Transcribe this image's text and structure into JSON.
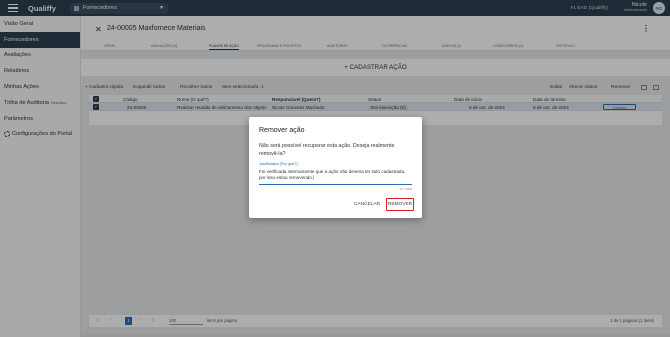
{
  "topbar": {
    "app_name": "Qualiffy",
    "module": "Fornecedores",
    "env": "FL EAD (Qualiffy)",
    "user_name": "Nicole",
    "user_role": "Administrador",
    "avatar": "NG"
  },
  "sidebar": {
    "items": [
      {
        "label": "Visão Geral",
        "sub": ""
      },
      {
        "label": "Fornecedores",
        "sub": ""
      },
      {
        "label": "Avaliações",
        "sub": ""
      },
      {
        "label": "Relatórios",
        "sub": ""
      },
      {
        "label": "Minhas Ações",
        "sub": ""
      },
      {
        "label": "Trilha de Auditoria",
        "sub": "Descritivo"
      },
      {
        "label": "Parâmetros",
        "sub": ""
      },
      {
        "label": "Configurações do Portal",
        "sub": ""
      }
    ]
  },
  "page": {
    "title": "24-00005 Maxfornece Materiais"
  },
  "tabs": [
    "GERAL",
    "AVALIAÇÕES (0)",
    "PLANOS DE AÇÃO",
    "PROGRAMAS E PROJETOS",
    "AUDITORIAS",
    "OCORRÊNCIAS",
    "ANEXOS (2)",
    "COMENTÁRIOS (0)",
    "HISTÓRICO"
  ],
  "cadastrar": "+ CADASTRAR AÇÃO",
  "toolbar": {
    "rapido": "+ Cadastro rápido",
    "expandir": "Expandir todos",
    "recolher": "Recolher todos",
    "selecionado": "Item selecionado: 1",
    "editar": "Editar",
    "alterar": "Alterar status",
    "remover": "Remover"
  },
  "table": {
    "headers": [
      "Código",
      "Nome (O quê?)",
      "Responsável (Quem?)",
      "Status",
      "Data de início",
      "Data de término"
    ],
    "row": {
      "codigo": "24-00046",
      "nome": "Realizar reunião de alinhamento dos objetiv",
      "responsavel": "Nicole Gimenez Machado",
      "status": "Em execução (0)",
      "inicio": "8 de out. de 2024",
      "termino": "9 de out. de 2024",
      "opcoes": "Opções"
    }
  },
  "pager": {
    "page": "1",
    "size": "100",
    "size_label": "itens por página",
    "info": "1 de 1 páginas (1 itens)"
  },
  "dialog": {
    "title": "Remover ação",
    "message": "Não será possível recuperar esta ação. Deseja realmente removê-la?",
    "field_label": "Justificativa (Por quê?)",
    "field_value": "Foi verificada internamente que a ação não deveria ter sido cadastrada, por isso estou removendo.|",
    "counter": "97 / 4000",
    "cancel": "CANCELAR",
    "remove": "REMOVER"
  }
}
